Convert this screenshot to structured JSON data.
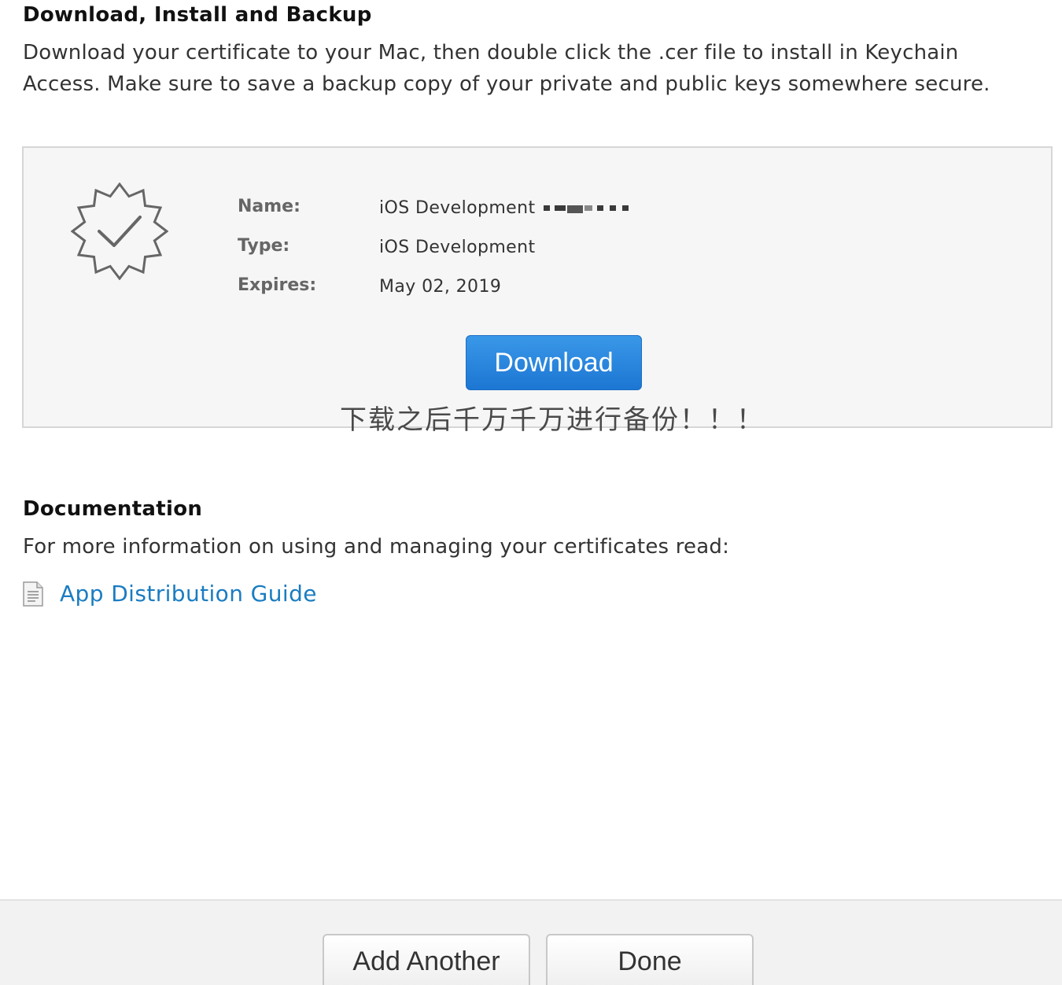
{
  "backup_section": {
    "title": "Download, Install and Backup",
    "description": "Download your certificate to your Mac, then double click the .cer file to install in Keychain Access. Make sure to save a backup copy of your private and public keys somewhere secure."
  },
  "certificate": {
    "badge_icon": "certificate-check-badge-icon",
    "fields": [
      {
        "label": "Name:",
        "value": "iOS Development"
      },
      {
        "label": "Type:",
        "value": "iOS Development"
      },
      {
        "label": "Expires:",
        "value": "May 02, 2019"
      }
    ],
    "download_label": "Download"
  },
  "annotation": "下载之后千万千万进行备份！！！",
  "documentation": {
    "title": "Documentation",
    "description": "For more information on using and managing your certificates read:",
    "link_icon": "document-icon",
    "link_label": "App Distribution Guide"
  },
  "footer": {
    "add_another_label": "Add Another",
    "done_label": "Done"
  },
  "colors": {
    "accent_button": "#1c76d3",
    "link": "#1a7cc1",
    "panel_bg": "#f6f6f6"
  }
}
